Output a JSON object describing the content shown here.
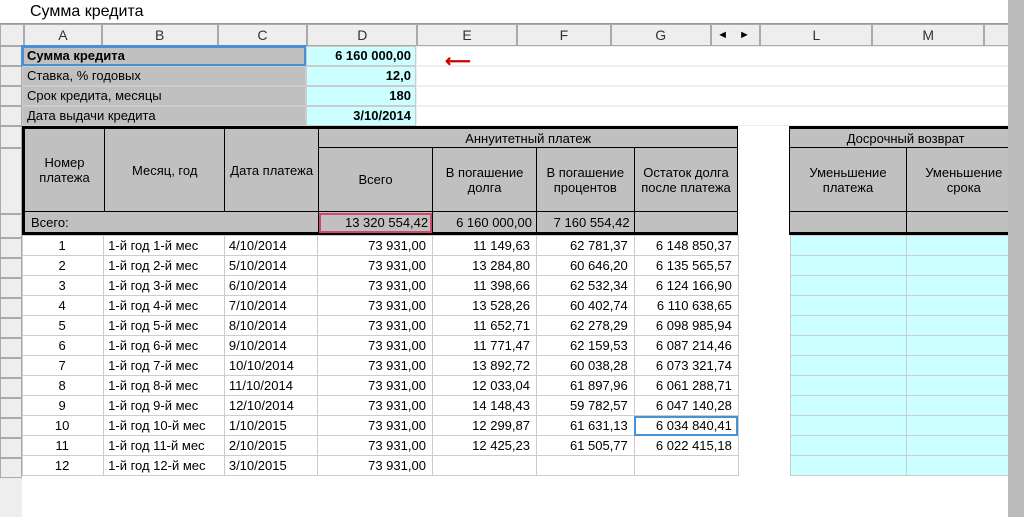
{
  "formula_bar": "Сумма кредита",
  "cols": [
    "A",
    "B",
    "C",
    "D",
    "E",
    "F",
    "G",
    "L",
    "M"
  ],
  "params": {
    "amount_label": "Сумма кредита",
    "amount_value": "6 160 000,00",
    "rate_label": "Ставка, % годовых",
    "rate_value": "12,0",
    "term_label": "Срок кредита, месяцы",
    "term_value": "180",
    "date_label": "Дата выдачи кредита",
    "date_value": "3/10/2014"
  },
  "headers": {
    "num": "Номер платежа",
    "month_year": "Месяц, год",
    "pay_date": "Дата платежа",
    "annuity": "Аннуитетный платеж",
    "total": "Всего",
    "principal": "В погашение долга",
    "interest": "В погашение процентов",
    "balance": "Остаток долга после платежа",
    "early": "Досрочный возврат",
    "reduce_pay": "Уменьшение платежа",
    "reduce_term": "Уменьшение срока",
    "totals_label": "Всего:"
  },
  "totals": {
    "total": "13 320 554,42",
    "principal": "6 160 000,00",
    "interest": "7 160 554,42"
  },
  "rows": [
    {
      "n": "1",
      "my": "1-й год 1-й мес",
      "d": "4/10/2014",
      "t": "73 931,00",
      "p": "11 149,63",
      "i": "62 781,37",
      "b": "6 148 850,37"
    },
    {
      "n": "2",
      "my": "1-й год 2-й мес",
      "d": "5/10/2014",
      "t": "73 931,00",
      "p": "13 284,80",
      "i": "60 646,20",
      "b": "6 135 565,57"
    },
    {
      "n": "3",
      "my": "1-й год 3-й мес",
      "d": "6/10/2014",
      "t": "73 931,00",
      "p": "11 398,66",
      "i": "62 532,34",
      "b": "6 124 166,90"
    },
    {
      "n": "4",
      "my": "1-й год 4-й мес",
      "d": "7/10/2014",
      "t": "73 931,00",
      "p": "13 528,26",
      "i": "60 402,74",
      "b": "6 110 638,65"
    },
    {
      "n": "5",
      "my": "1-й год 5-й мес",
      "d": "8/10/2014",
      "t": "73 931,00",
      "p": "11 652,71",
      "i": "62 278,29",
      "b": "6 098 985,94"
    },
    {
      "n": "6",
      "my": "1-й год 6-й мес",
      "d": "9/10/2014",
      "t": "73 931,00",
      "p": "11 771,47",
      "i": "62 159,53",
      "b": "6 087 214,46"
    },
    {
      "n": "7",
      "my": "1-й год 7-й мес",
      "d": "10/10/2014",
      "t": "73 931,00",
      "p": "13 892,72",
      "i": "60 038,28",
      "b": "6 073 321,74"
    },
    {
      "n": "8",
      "my": "1-й год 8-й мес",
      "d": "11/10/2014",
      "t": "73 931,00",
      "p": "12 033,04",
      "i": "61 897,96",
      "b": "6 061 288,71"
    },
    {
      "n": "9",
      "my": "1-й год 9-й мес",
      "d": "12/10/2014",
      "t": "73 931,00",
      "p": "14 148,43",
      "i": "59 782,57",
      "b": "6 047 140,28"
    },
    {
      "n": "10",
      "my": "1-й год 10-й мес",
      "d": "1/10/2015",
      "t": "73 931,00",
      "p": "12 299,87",
      "i": "61 631,13",
      "b": "6 034 840,41"
    },
    {
      "n": "11",
      "my": "1-й год 11-й мес",
      "d": "2/10/2015",
      "t": "73 931,00",
      "p": "12 425,23",
      "i": "61 505,77",
      "b": "6 022 415,18"
    },
    {
      "n": "12",
      "my": "1-й год 12-й мес",
      "d": "3/10/2015",
      "t": "73 931,00",
      "p": "",
      "i": "",
      "b": ""
    }
  ],
  "selected_balance_row_index": 9
}
